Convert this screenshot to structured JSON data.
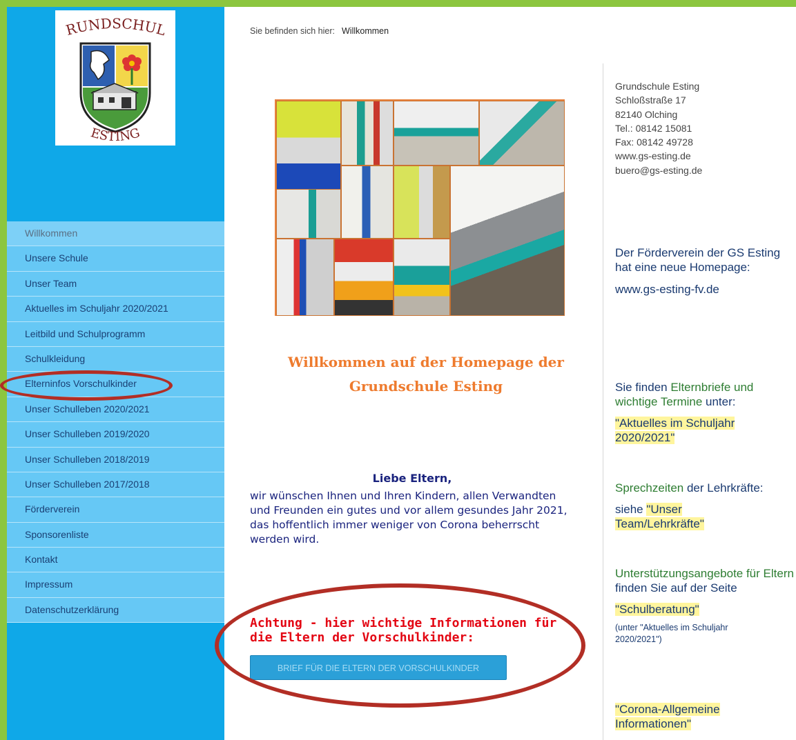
{
  "breadcrumb": {
    "prefix": "Sie befinden sich hier:",
    "current": "Willkommen"
  },
  "logo": {
    "top_text": "GRUNDSCHULE",
    "bottom_text": "ESTING"
  },
  "nav": {
    "items": [
      "Willkommen",
      "Unsere Schule",
      "Unser Team",
      "Aktuelles im Schuljahr 2020/2021",
      "Leitbild und Schulprogramm",
      "Schulkleidung",
      "Elterninfos Vorschulkinder",
      "Unser Schulleben 2020/2021",
      "Unser Schulleben 2019/2020",
      "Unser Schulleben 2018/2019",
      "Unser Schulleben 2017/2018",
      "Förderverein",
      "Sponsorenliste",
      "Kontakt",
      "Impressum",
      "Datenschutzerklärung"
    ],
    "active_index": 0
  },
  "welcome": {
    "line1": "Willkommen auf der Homepage der",
    "line2": "Grundschule Esting"
  },
  "greeting": {
    "hello": "Liebe Eltern,",
    "body": "wir wünschen Ihnen und Ihren Kindern, allen Verwandten und Freunden ein gutes und vor allem gesundes Jahr 2021, das hoffentlich immer weniger von Corona beherrscht werden wird."
  },
  "warning": {
    "line1": "Achtung - hier wichtige Informationen für",
    "line2": "die Eltern der Vorschulkinder:"
  },
  "button": {
    "label": "BRIEF FÜR DIE ELTERN DER VORSCHULKINDER"
  },
  "address": {
    "name": "Grundschule Esting",
    "street": "Schloßstraße 17",
    "city": "82140 Olching",
    "tel": "Tel.: 08142 15081",
    "fax": "Fax: 08142 49728",
    "web": "www.gs-esting.de",
    "email": "buero@gs-esting.de"
  },
  "foerderverein": {
    "text": "Der Förderverein der GS Esting hat eine neue Homepage:",
    "link": "www.gs-esting-fv.de"
  },
  "elternbriefe": {
    "t1": "Sie finden ",
    "t2": "Elternbriefe und wichtige Termine",
    "t3": " unter:",
    "link": "\"Aktuelles im Schuljahr 2020/2021\""
  },
  "sprechzeiten": {
    "t1": "Sprechzeiten",
    "t2": " der Lehrkräfte:",
    "t3": "siehe ",
    "link": "\"Unser Team/Lehrkräfte\""
  },
  "unterstuetzung": {
    "t1": "Unterstützungsangebote für Eltern",
    "t2": " finden Sie auf der Seite",
    "link": "\"Schulberatung\"",
    "note": "(unter \"Aktuelles im Schuljahr 2020/2021\")"
  },
  "corona": {
    "link": "\"Corona-Allgemeine Informationen\""
  },
  "colors": {
    "frame": "#8cc63f",
    "sidebar": "#0fa8e8",
    "nav": "#66c8f5",
    "welcome": "#ee7b2e",
    "warning": "#e30613",
    "annotation": "#b22e25"
  }
}
